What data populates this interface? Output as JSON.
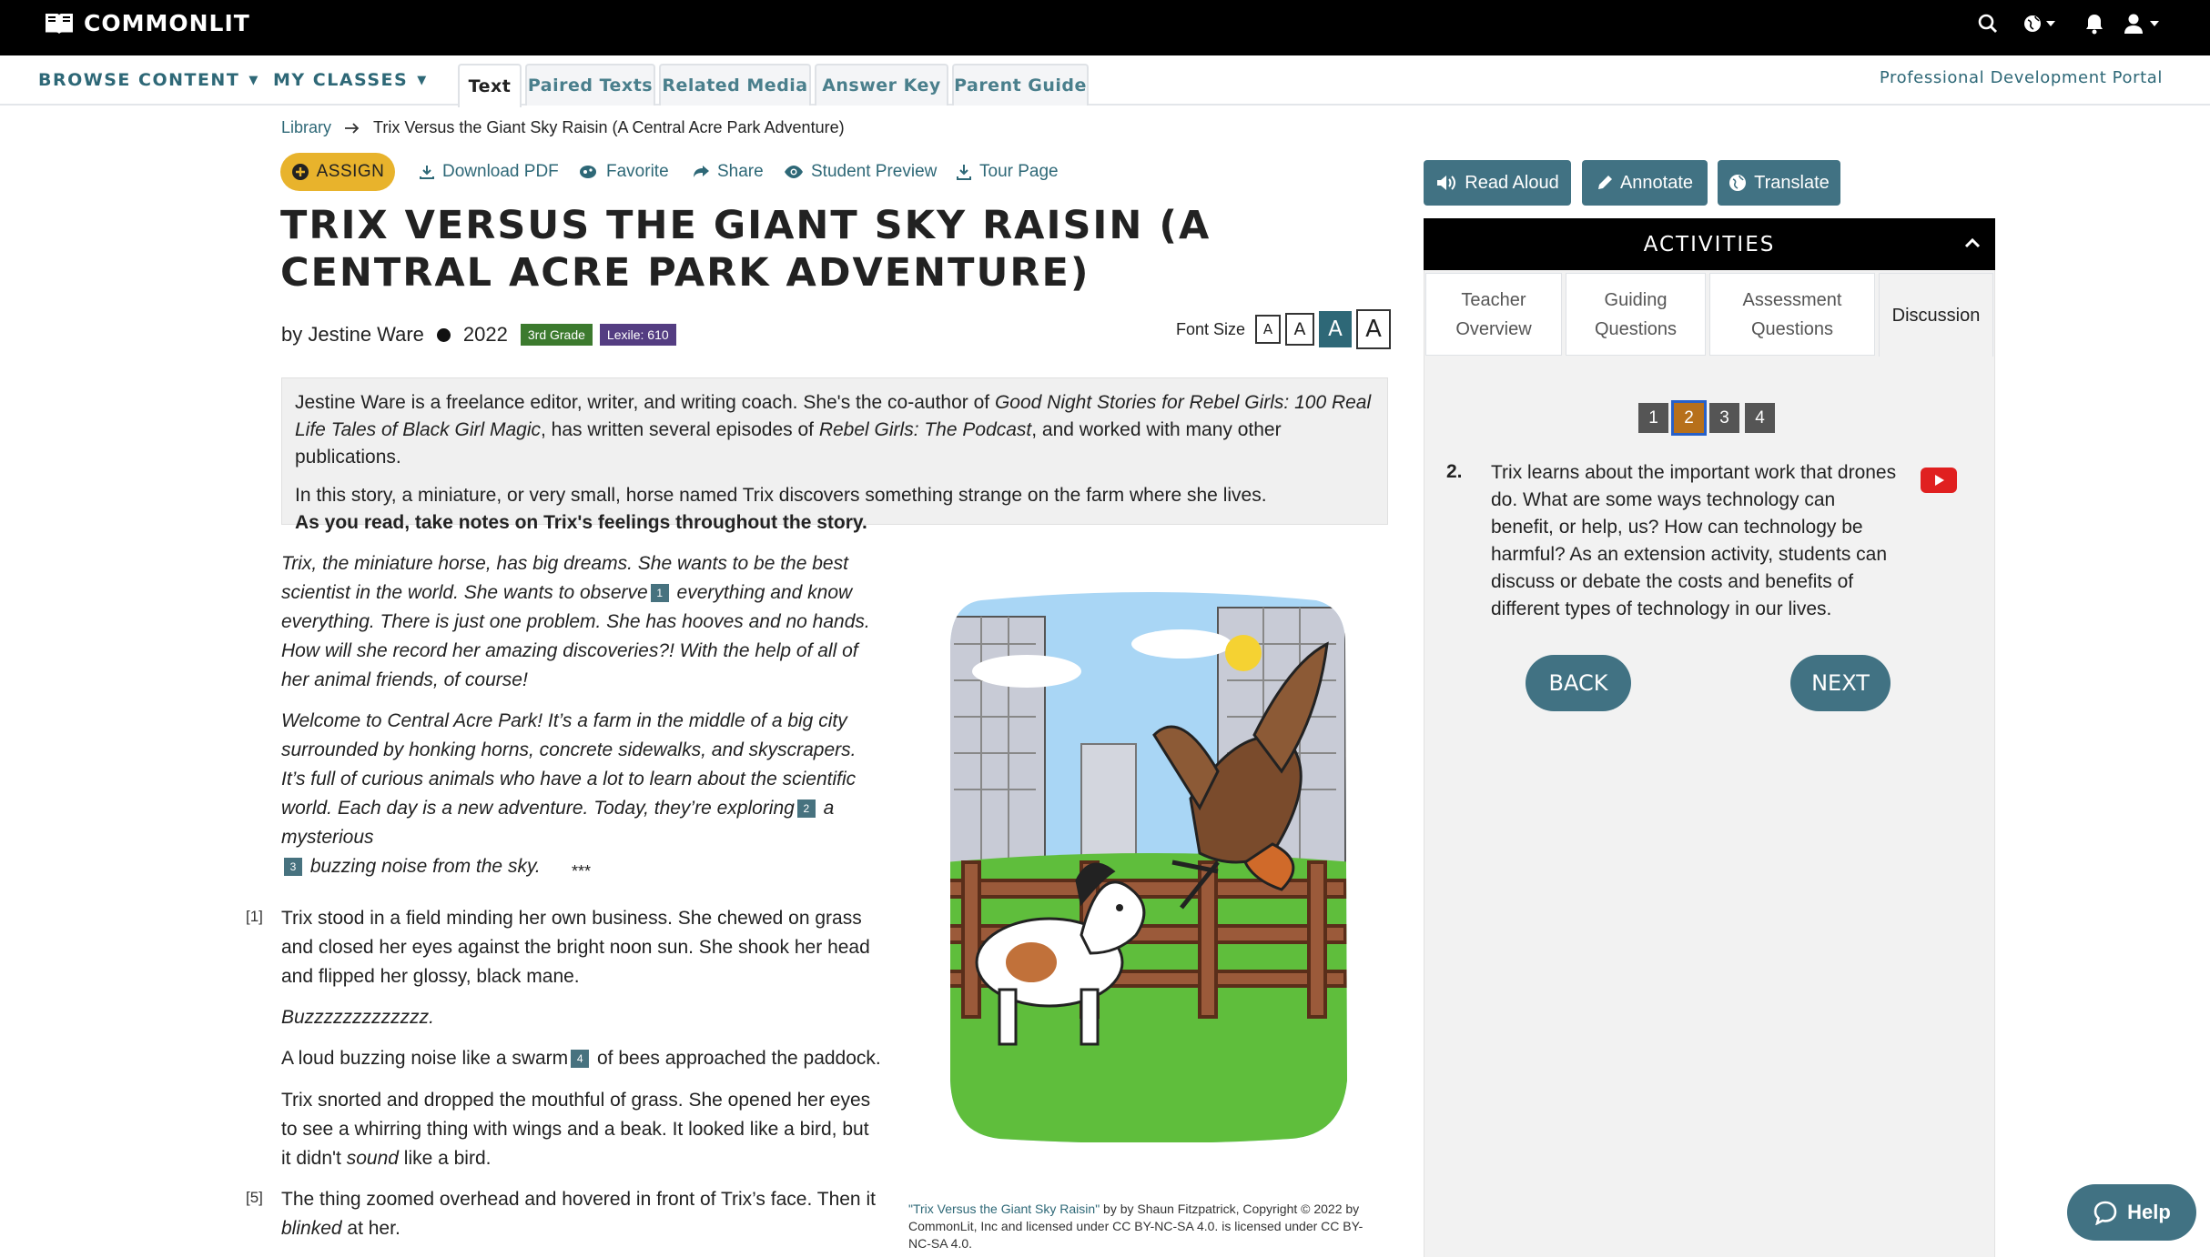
{
  "app": {
    "logo_text": "COMMONLIT"
  },
  "nav": {
    "browse": "BROWSE CONTENT",
    "classes": "MY CLASSES",
    "tabs": [
      {
        "label": "Text",
        "active": true
      },
      {
        "label": "Paired Texts",
        "active": false
      },
      {
        "label": "Related Media",
        "active": false
      },
      {
        "label": "Answer Key",
        "active": false
      },
      {
        "label": "Parent Guide",
        "active": false
      }
    ],
    "pd_portal": "Professional Development Portal"
  },
  "breadcrumb": {
    "library": "Library",
    "current": "Trix Versus the Giant Sky Raisin (A Central Acre Park Adventure)"
  },
  "toolbar": {
    "assign": "ASSIGN",
    "download": "Download PDF",
    "favorite": "Favorite",
    "share": "Share",
    "preview": "Student Preview",
    "tour": "Tour Page"
  },
  "text": {
    "title": "TRIX VERSUS THE GIANT SKY RAISIN (A CENTRAL ACRE PARK ADVENTURE)",
    "author": "by Jestine Ware",
    "year": "2022",
    "grade": "3rd Grade",
    "lexile": "Lexile: 610",
    "font_size_label": "Font Size",
    "font_size_buttons": [
      "A",
      "A",
      "A",
      "A"
    ]
  },
  "intro": {
    "p1_a": "Jestine Ware is a freelance editor, writer, and writing coach. She's the co-author of ",
    "p1_b": "Good Night Stories for Rebel Girls: 100 Real Life Tales of Black Girl Magic",
    "p1_c": ", has written several episodes of ",
    "p1_d": "Rebel Girls: The Podcast",
    "p1_e": ", and worked with many other publications.",
    "p2": "In this story, a miniature, or very small, horse named Trix discovers something strange on the farm where she lives.",
    "p3": "As you read, take notes on Trix's feelings throughout the story."
  },
  "story": {
    "it1_a": "Trix, the miniature horse, has big dreams. She wants to be the best scientist in the world. She wants to observe",
    "it1_b": " everything and know everything. There is just one problem. She has hooves and no hands. How will she record her amazing discoveries?! With the help of all of her animal friends, of course!",
    "it2_a": "Welcome to Central Acre Park! It’s a farm in the middle of a big city surrounded by honking horns, concrete sidewalks, and skyscrapers. It’s full of curious animals who have a lot to learn about the scientific world. Each day is a new adventure. Today, they’re exploring",
    "it2_b": " a mysterious",
    "it2_c": " buzzing noise from the sky.",
    "stars": "***",
    "pnum1": "[1]",
    "p1": "Trix stood in a field minding her own business. She chewed on grass and closed her eyes against the bright noon sun. She shook her head and flipped her glossy, black mane.",
    "p2": "Buzzzzzzzzzzzzz.",
    "p3_a": "A loud buzzing noise like a swarm",
    "p3_b": " of bees approached the paddock.",
    "p4_a": "Trix snorted and dropped the mouthful of grass. She opened her eyes to see a whirring thing with wings and a beak. It looked like a bird, but it didn't ",
    "p4_b": "sound",
    "p4_c": " like a bird.",
    "pnum5": "[5]",
    "p5_a": "The thing zoomed overhead and hovered in front of Trix’s face. Then it ",
    "p5_b": "blinked",
    "p5_c": " at her.",
    "footnotes": [
      "1",
      "2",
      "3",
      "4"
    ]
  },
  "caption": {
    "link": "\"Trix Versus the Giant Sky Raisin\"",
    "rest": " by by Shaun Fitzpatrick, Copyright © 2022 by CommonLit, Inc and licensed under CC BY-NC-SA 4.0. is licensed under CC BY-NC-SA 4.0."
  },
  "right": {
    "read_aloud": "Read Aloud",
    "annotate": "Annotate",
    "translate": "Translate",
    "activities": "ACTIVITIES",
    "tabs": [
      {
        "l1": "Teacher",
        "l2": "Overview"
      },
      {
        "l1": "Guiding",
        "l2": "Questions"
      },
      {
        "l1": "Assessment",
        "l2": "Questions"
      },
      {
        "l1": "Discussion",
        "l2": ""
      }
    ],
    "question_numbers": [
      "1",
      "2",
      "3",
      "4"
    ],
    "selected_question": "2",
    "q_num": "2.",
    "q_text": "Trix learns about the important work that drones do. What are some ways technology can benefit, or help, us? How can technology be harmful? As an extension activity, students can discuss or debate the costs and benefits of different types of technology in our lives.",
    "back": "BACK",
    "next": "NEXT"
  },
  "help": "Help",
  "colors": {
    "teal": "#417283",
    "link": "#2e6877",
    "assign": "#e8b32c",
    "grade": "#3c7a2e",
    "lexile": "#543d82",
    "selected_q": "#b7701b"
  }
}
